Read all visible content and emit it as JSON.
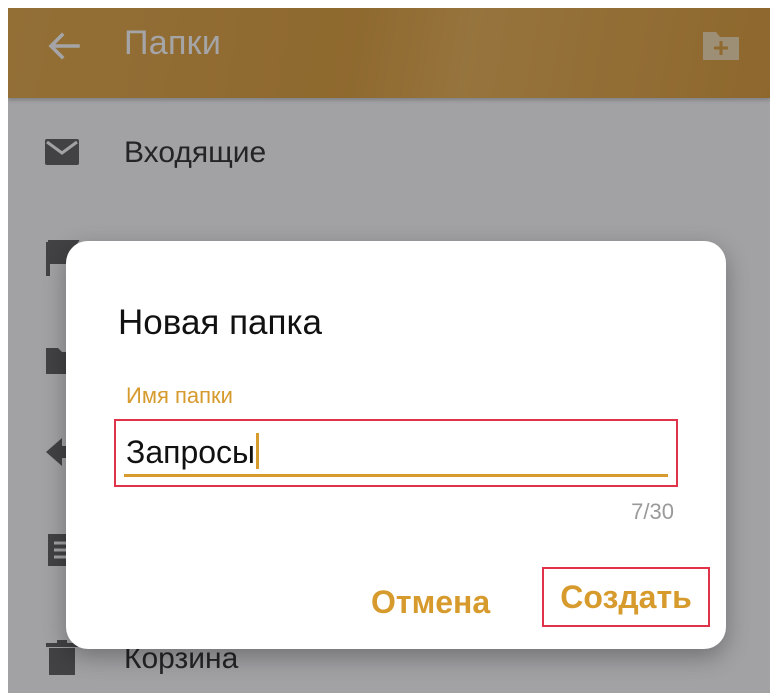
{
  "appbar": {
    "title": "Папки",
    "back_icon": "arrow-left-icon",
    "add_folder_icon": "folder-plus-icon",
    "color": "#d9982f"
  },
  "folders": [
    {
      "label": "Входящие",
      "icon": "envelope-icon"
    },
    {
      "label": "",
      "icon": "flag-icon"
    },
    {
      "label": "",
      "icon": "folder-icon"
    },
    {
      "label": "",
      "icon": "send-icon"
    },
    {
      "label": "",
      "icon": "document-icon"
    },
    {
      "label": "Корзина",
      "icon": "trash-icon"
    }
  ],
  "dialog": {
    "title": "Новая папка",
    "field_label": "Имя папки",
    "field_value": "Запросы",
    "counter": "7/30",
    "cancel_label": "Отмена",
    "create_label": "Создать",
    "accent_color": "#d69a2d",
    "highlight_color": "#e0334a"
  }
}
